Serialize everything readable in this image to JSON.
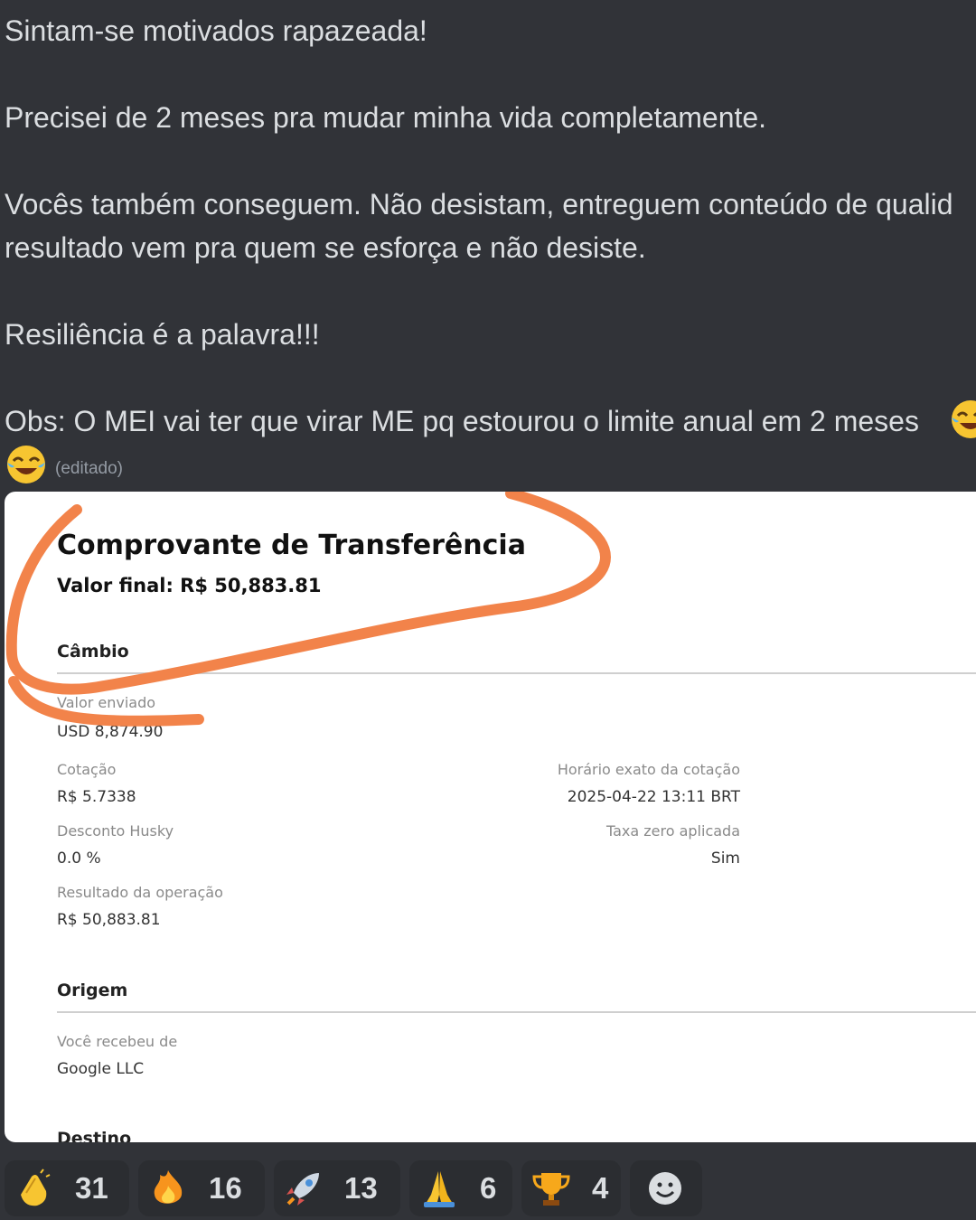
{
  "message": {
    "lines": [
      "Sintam-se motivados rapazeada!",
      "Precisei de 2 meses pra mudar minha vida completamente.",
      "Vocês também conseguem. Não desistam, entreguem conteúdo de qualid",
      "resultado vem pra quem se esforça e não desiste.",
      "Resiliência é a palavra!!!",
      "Obs: O MEI vai ter que virar ME pq estourou o limite anual em 2 meses"
    ],
    "edited": "(editado)",
    "emoji": "face-with-tears-of-joy-icon"
  },
  "receipt": {
    "title": "Comprovante de Transferência",
    "final_value": "Valor final: R$ 50,883.81",
    "cambio": {
      "section": "Câmbio",
      "valor_enviado_label": "Valor enviado",
      "valor_enviado_value": "USD 8,874.90",
      "cotacao_label": "Cotação",
      "cotacao_value": "R$ 5.7338",
      "horario_label": "Horário exato da cotação",
      "horario_value": "2025-04-22 13:11 BRT",
      "desconto_label": "Desconto Husky",
      "desconto_value": "0.0 %",
      "taxa_label": "Taxa zero aplicada",
      "taxa_value": "Sim",
      "resultado_label": "Resultado da operação",
      "resultado_value": "R$ 50,883.81"
    },
    "origem": {
      "section": "Origem",
      "recebeu_label": "Você recebeu de",
      "recebeu_value": "Google LLC"
    },
    "destino": {
      "section": "Destino"
    },
    "annotation_color": "#f2834a"
  },
  "reactions": [
    {
      "emoji": "clapping-hands-icon",
      "count": "31"
    },
    {
      "emoji": "fire-icon",
      "count": "16"
    },
    {
      "emoji": "rocket-icon",
      "count": "13"
    },
    {
      "emoji": "folded-hands-icon",
      "count": "6"
    },
    {
      "emoji": "trophy-icon",
      "count": "4"
    },
    {
      "emoji": "add-reaction-icon",
      "count": ""
    }
  ]
}
